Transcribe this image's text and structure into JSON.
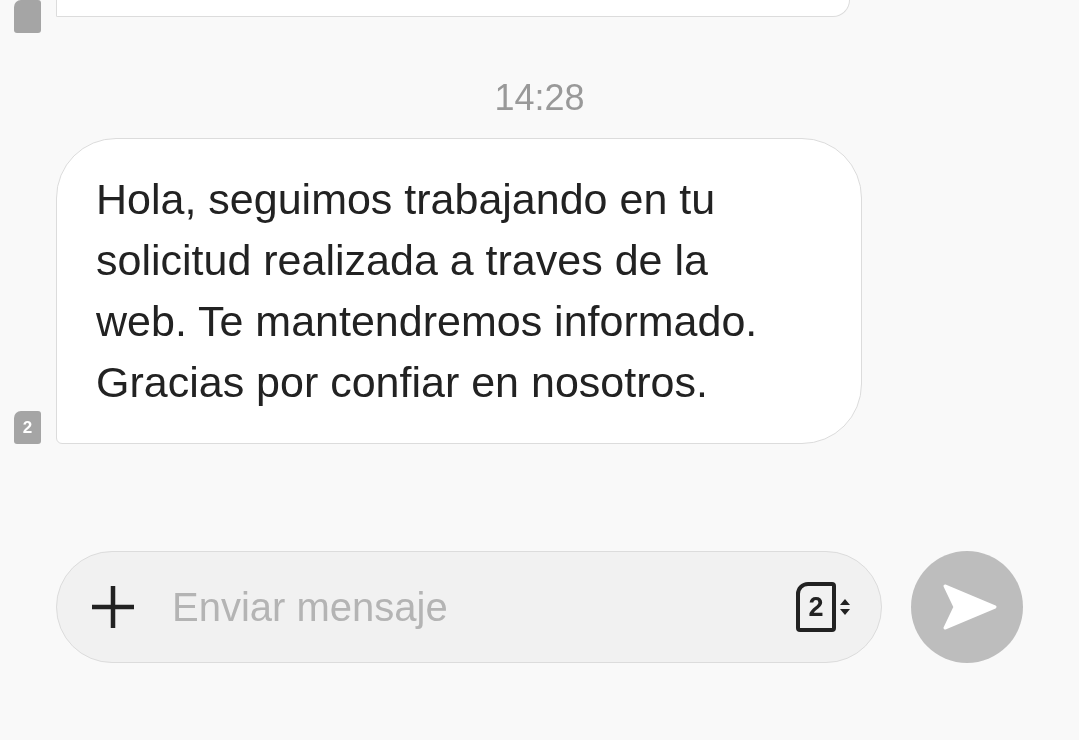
{
  "previous_message": {
    "kind": "incoming"
  },
  "timestamp": "14:28",
  "messages": [
    {
      "kind": "incoming",
      "text": "Hola, seguimos trabajando en tu solicitud realizada a traves de la web. Te mantendremos informado. Gracias por confiar en nosotros.",
      "sim": "2"
    }
  ],
  "composer": {
    "placeholder": "Enviar mensaje",
    "sim": "2"
  }
}
